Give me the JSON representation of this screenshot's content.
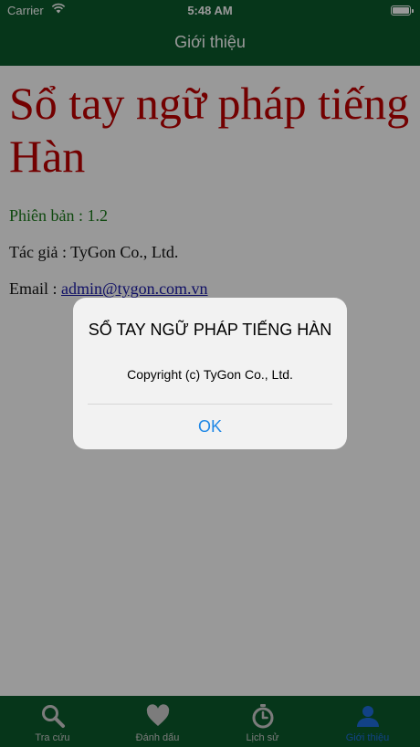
{
  "status_bar": {
    "carrier": "Carrier",
    "time": "5:48 AM"
  },
  "nav": {
    "title": "Giới thiệu"
  },
  "about": {
    "app_name": "Sổ tay ngữ pháp tiếng Hàn",
    "version": "Phiên bản : 1.2",
    "author": "Tác giả : TyGon Co., Ltd.",
    "email_label": "Email : ",
    "email": "admin@tygon.com.vn"
  },
  "alert": {
    "title": "SỔ TAY NGỮ PHÁP TIẾNG HÀN",
    "message": "Copyright (c) TyGon Co., Ltd.",
    "ok_label": "OK"
  },
  "tabs": [
    {
      "label": "Tra cứu",
      "icon": "search-icon"
    },
    {
      "label": "Đánh dấu",
      "icon": "heart-icon"
    },
    {
      "label": "Lịch sử",
      "icon": "stopwatch-icon"
    },
    {
      "label": "Giới thiệu",
      "icon": "person-icon",
      "active": true
    }
  ],
  "colors": {
    "header_bg": "#0b5a2c",
    "title_red": "#c00000",
    "version_green": "#1a7a1a",
    "link_blue": "#1a1aa8",
    "active_tab": "#1e6fe0",
    "alert_button": "#1e87e6"
  }
}
